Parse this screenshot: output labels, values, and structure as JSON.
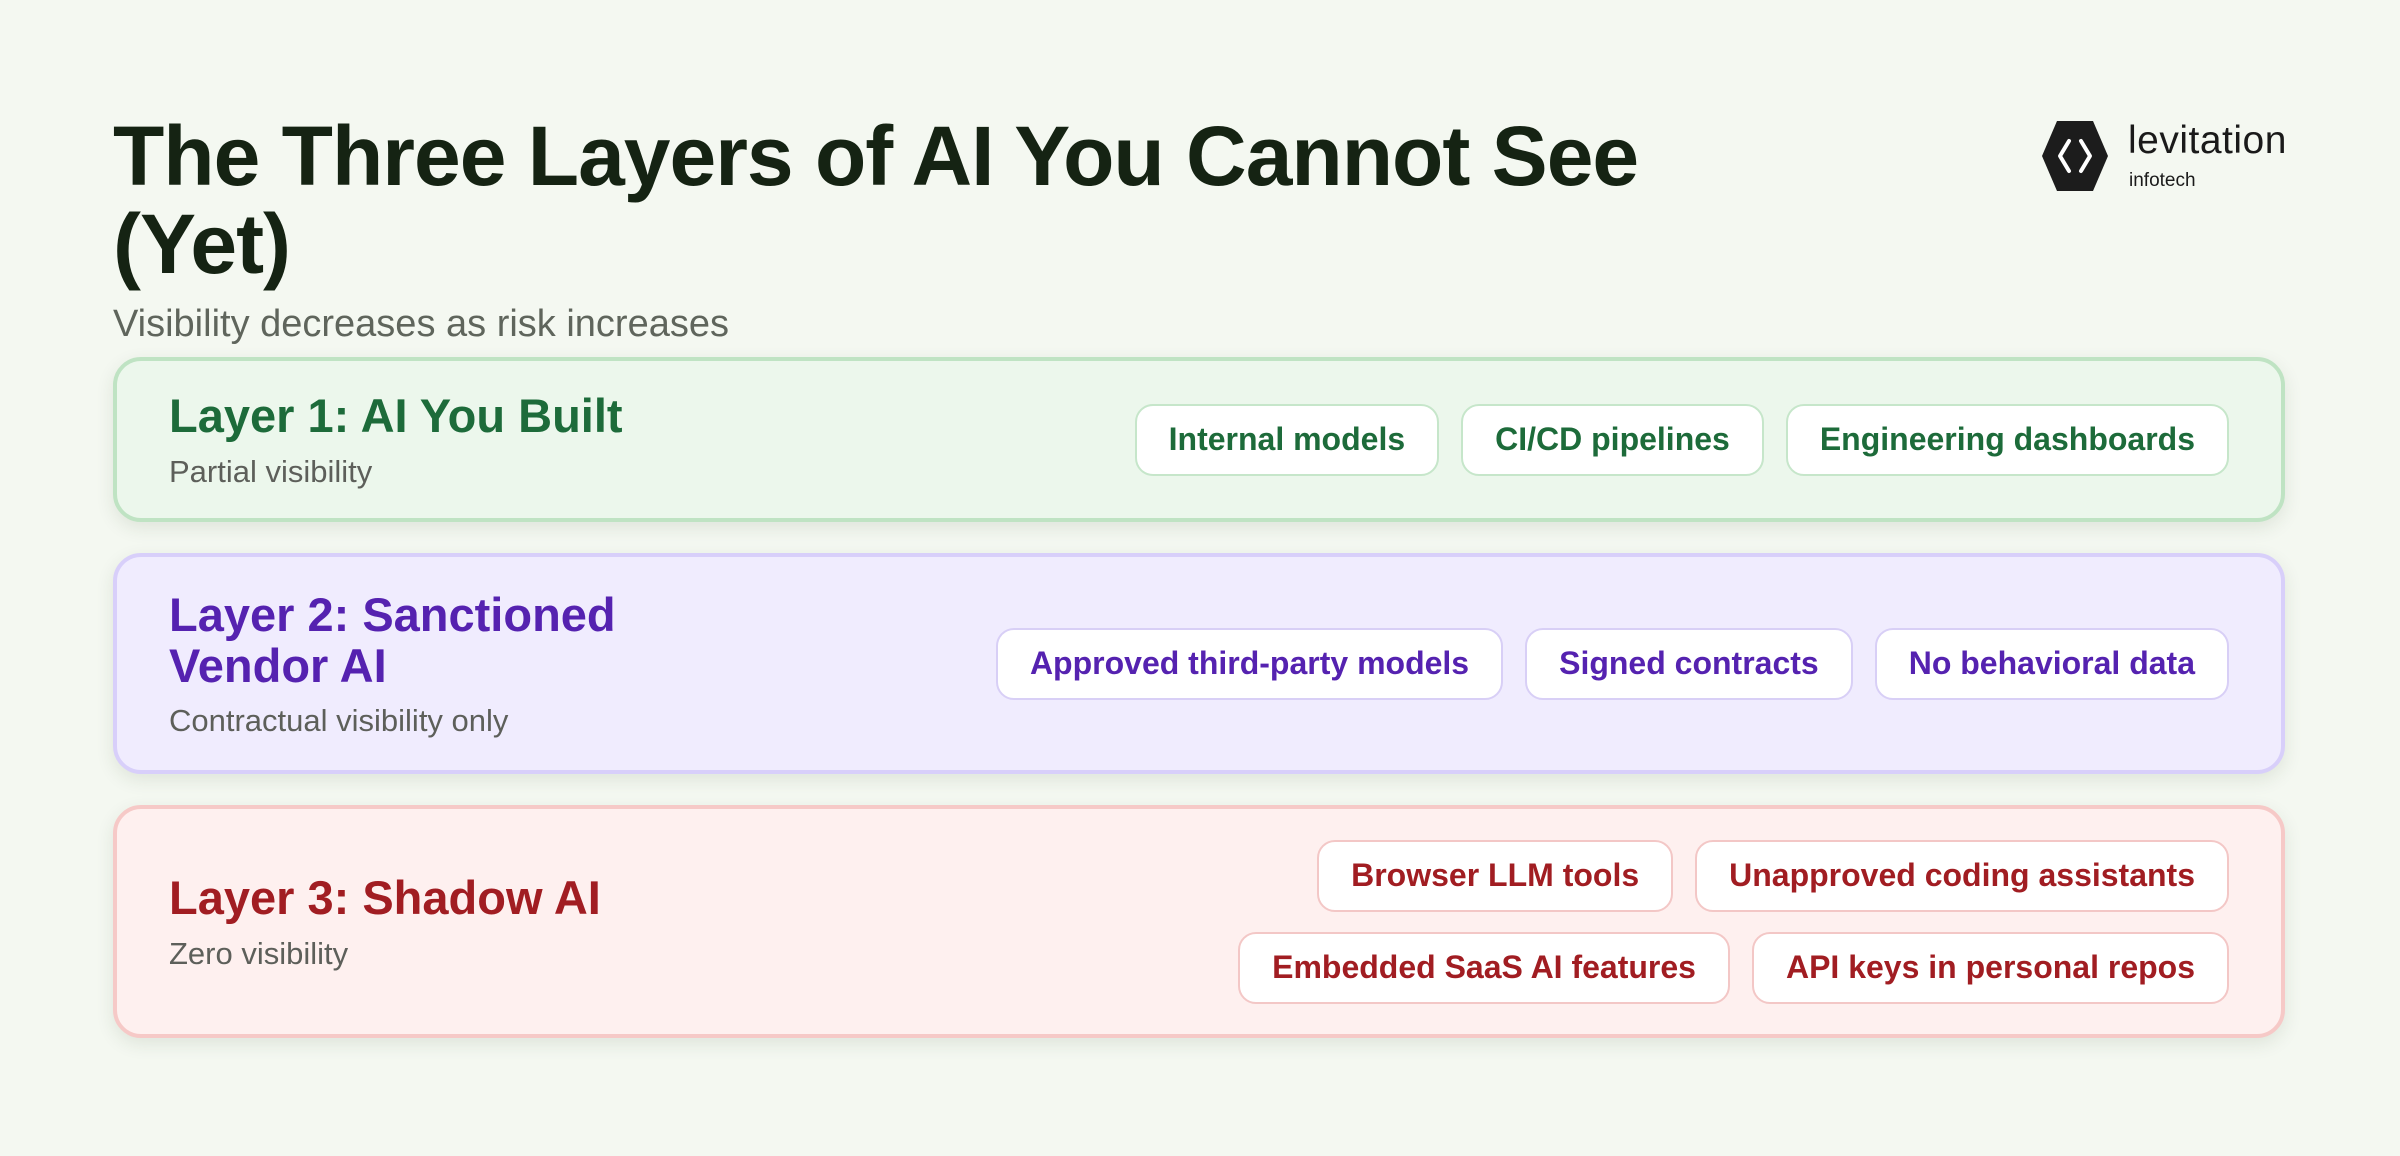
{
  "header": {
    "title": "The Three Layers of AI You Cannot See (Yet)",
    "subtitle": "Visibility decreases as risk increases"
  },
  "logo": {
    "name": "levitation",
    "sub": "infotech",
    "icon": "hexagon-brackets-icon"
  },
  "layers": [
    {
      "title": "Layer 1: AI You Built",
      "description": "Partial visibility",
      "tags": [
        "Internal models",
        "CI/CD pipelines",
        "Engineering dashboards"
      ]
    },
    {
      "title": "Layer 2: Sanctioned Vendor AI",
      "description": "Contractual visibility only",
      "tags": [
        "Approved third-party models",
        "Signed contracts",
        "No behavioral data"
      ]
    },
    {
      "title": "Layer 3: Shadow AI",
      "description": "Zero visibility",
      "tags": [
        "Browser LLM tools",
        "Unapproved coding assistants",
        "Embedded SaaS AI features",
        "API keys in personal repos"
      ]
    }
  ],
  "colors": {
    "background": "#f4f8f1",
    "title": "#152313",
    "layer1_accent": "#1d6b3a",
    "layer1_fill": "#ecf7ec",
    "layer2_accent": "#5522b0",
    "layer2_fill": "#f0ecfe",
    "layer3_accent": "#a11d22",
    "layer3_fill": "#fef0ef"
  }
}
